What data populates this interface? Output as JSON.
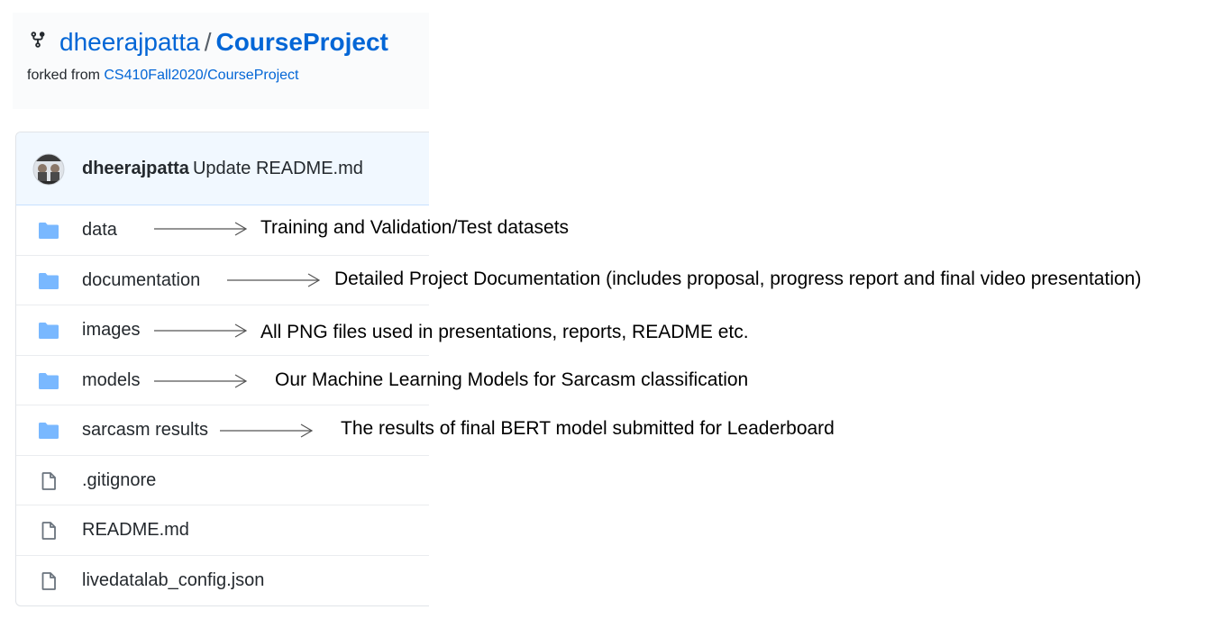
{
  "repo": {
    "owner": "dheerajpatta",
    "separator": "/",
    "name": "CourseProject",
    "forked_prefix": "forked from",
    "forked_source": "CS410Fall2020/CourseProject"
  },
  "commit": {
    "author": "dheerajpatta",
    "message": "Update README.md"
  },
  "files": [
    {
      "name": "data",
      "type": "folder"
    },
    {
      "name": "documentation",
      "type": "folder"
    },
    {
      "name": "images",
      "type": "folder"
    },
    {
      "name": "models",
      "type": "folder"
    },
    {
      "name": "sarcasm results",
      "type": "folder"
    },
    {
      "name": ".gitignore",
      "type": "file"
    },
    {
      "name": "README.md",
      "type": "file"
    },
    {
      "name": "livedatalab_config.json",
      "type": "file"
    }
  ],
  "annotations": [
    {
      "target": "data",
      "text": "Training and Validation/Test datasets"
    },
    {
      "target": "documentation",
      "text": "Detailed Project Documentation (includes proposal, progress report and final video presentation)"
    },
    {
      "target": "images",
      "text": "All PNG files used in presentations, reports, README etc."
    },
    {
      "target": "models",
      "text": "Our Machine Learning Models for Sarcasm classification"
    },
    {
      "target": "sarcasm results",
      "text": "The results of final BERT model submitted for Leaderboard"
    }
  ],
  "colors": {
    "link": "#0366d6",
    "folder_icon": "#79b8ff",
    "file_icon": "#6a737d",
    "commit_bg": "#f1f8ff"
  },
  "icons": {
    "fork": "repo-forked-icon",
    "folder": "folder-icon",
    "file": "file-icon"
  }
}
